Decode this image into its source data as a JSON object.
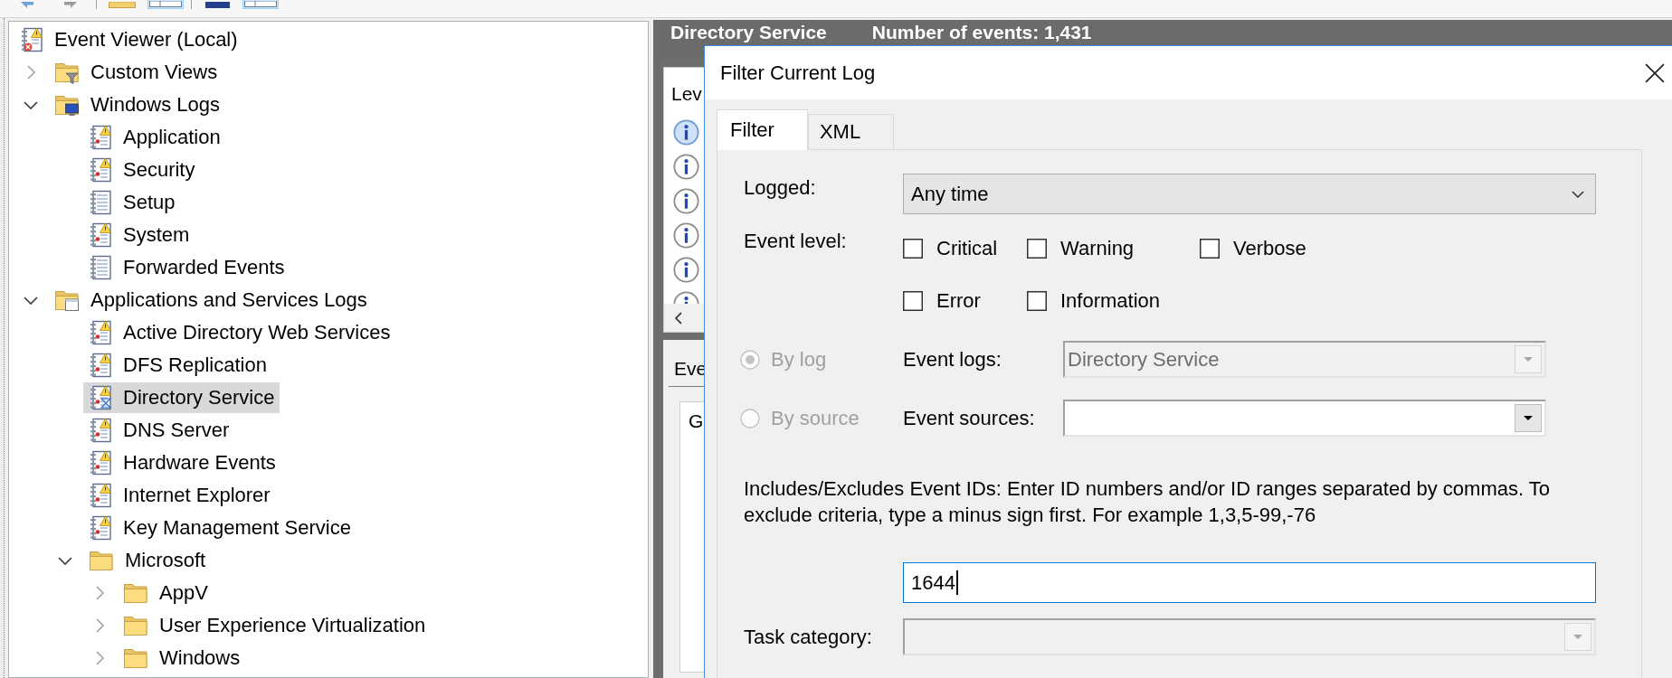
{
  "toolbar": {
    "groups": [
      [
        {
          "kind": "back",
          "pressed": false
        },
        {
          "kind": "forward",
          "pressed": false
        }
      ],
      [
        {
          "kind": "folder",
          "pressed": false
        },
        {
          "kind": "panes",
          "pressed": true
        }
      ],
      [
        {
          "kind": "book",
          "pressed": false
        },
        {
          "kind": "panes",
          "pressed": true
        }
      ]
    ]
  },
  "tree": {
    "items": [
      {
        "label": "Event Viewer (Local)",
        "kind": "root",
        "selected": false,
        "children": [
          {
            "label": "Custom Views",
            "kind": "viewfolder",
            "expanded": false,
            "selected": false
          },
          {
            "label": "Windows Logs",
            "kind": "logfolder",
            "expanded": true,
            "selected": false,
            "children": [
              {
                "label": "Application",
                "kind": "log",
                "selected": false
              },
              {
                "label": "Security",
                "kind": "log",
                "selected": false
              },
              {
                "label": "Setup",
                "kind": "plainlog",
                "selected": false
              },
              {
                "label": "System",
                "kind": "log",
                "selected": false
              },
              {
                "label": "Forwarded Events",
                "kind": "plainlog",
                "selected": false
              }
            ]
          },
          {
            "label": "Applications and Services Logs",
            "kind": "appfolder",
            "expanded": true,
            "selected": false,
            "children": [
              {
                "label": "Active Directory Web Services",
                "kind": "log",
                "selected": false
              },
              {
                "label": "DFS Replication",
                "kind": "log",
                "selected": false
              },
              {
                "label": "Directory Service",
                "kind": "busylog",
                "selected": true
              },
              {
                "label": "DNS Server",
                "kind": "log",
                "selected": false
              },
              {
                "label": "Hardware Events",
                "kind": "log",
                "selected": false
              },
              {
                "label": "Internet Explorer",
                "kind": "log",
                "selected": false
              },
              {
                "label": "Key Management Service",
                "kind": "log",
                "selected": false
              },
              {
                "label": "Microsoft",
                "kind": "folder",
                "expanded": true,
                "selected": false,
                "children": [
                  {
                    "label": "AppV",
                    "kind": "folder",
                    "expanded": false,
                    "selected": false
                  },
                  {
                    "label": "User Experience Virtualization",
                    "kind": "folder",
                    "expanded": false,
                    "selected": false
                  },
                  {
                    "label": "Windows",
                    "kind": "folder",
                    "expanded": false,
                    "selected": false
                  }
                ]
              }
            ]
          }
        ]
      }
    ]
  },
  "results": {
    "title": "Directory Service",
    "count": "Number of events: 1,431",
    "columns": [
      "Lev"
    ],
    "rows": [
      {
        "selected": true
      },
      {
        "selected": false
      },
      {
        "selected": false
      },
      {
        "selected": false
      },
      {
        "selected": false
      },
      {
        "selected": false
      }
    ],
    "details_tab": "Eve",
    "details_subtab": "G"
  },
  "dialog": {
    "title": "Filter Current Log",
    "tabs": [
      {
        "label": "Filter",
        "selected": true
      },
      {
        "label": "XML",
        "selected": false
      }
    ],
    "logged": {
      "label": "Logged:",
      "value": "Any time"
    },
    "event_level": {
      "label": "Event level:",
      "options": [
        {
          "label": "Critical",
          "checked": false
        },
        {
          "label": "Warning",
          "checked": false
        },
        {
          "label": "Verbose",
          "checked": false
        },
        {
          "label": "Error",
          "checked": false
        },
        {
          "label": "Information",
          "checked": false
        }
      ]
    },
    "scope": [
      {
        "label": "By log",
        "selected": true,
        "disabled": true,
        "field": {
          "label": "Event logs:",
          "value": "Directory Service",
          "disabled": true
        }
      },
      {
        "label": "By source",
        "selected": false,
        "disabled": true,
        "field": {
          "label": "Event sources:",
          "disabled": false
        }
      }
    ],
    "event_ids": {
      "description": "Includes/Excludes Event IDs: Enter ID numbers and/or ID ranges separated by commas. To exclude criteria, type a minus sign first. For example 1,3,5-99,-76",
      "value": "1644",
      "focused": true
    },
    "task_category": {
      "label": "Task category:",
      "disabled": true
    }
  }
}
